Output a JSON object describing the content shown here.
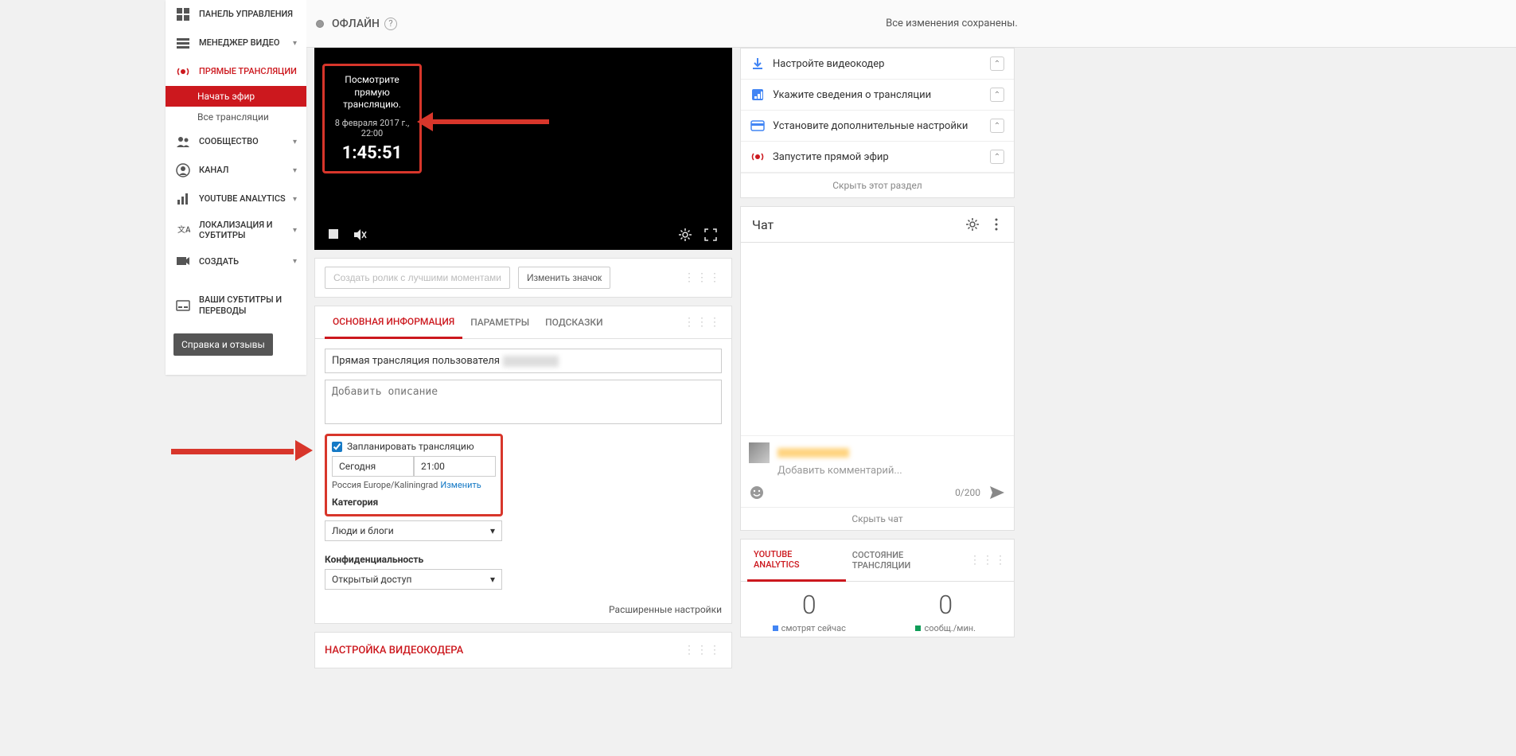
{
  "sidebar": {
    "items": [
      {
        "label": "ПАНЕЛЬ УПРАВЛЕНИЯ"
      },
      {
        "label": "МЕНЕДЖЕР ВИДЕО"
      },
      {
        "label": "ПРЯМЫЕ ТРАНСЛЯЦИИ"
      },
      {
        "label": "СООБЩЕСТВО"
      },
      {
        "label": "КАНАЛ"
      },
      {
        "label": "YOUTUBE ANALYTICS"
      },
      {
        "label": "ЛОКАЛИЗАЦИЯ И СУБТИТРЫ"
      },
      {
        "label": "СОЗДАТЬ"
      },
      {
        "label": "ВАШИ СУБТИТРЫ И ПЕРЕВОДЫ"
      }
    ],
    "sub_start": "Начать эфир",
    "sub_all": "Все трансляции",
    "help_button": "Справка и отзывы"
  },
  "header": {
    "status": "ОФЛАЙН",
    "saved": "Все изменения сохранены."
  },
  "player": {
    "overlay_title": "Посмотрите прямую трансляцию.",
    "overlay_date": "8 февраля 2017 г., 22:00",
    "overlay_countdown": "1:45:51"
  },
  "thumbnail_bar": {
    "create_clip": "Создать ролик с лучшими моментами",
    "change_thumb": "Изменить значок"
  },
  "tabs": {
    "basic": "ОСНОВНАЯ ИНФОРМАЦИЯ",
    "params": "ПАРАМЕТРЫ",
    "hints": "ПОДСКАЗКИ"
  },
  "form": {
    "title_prefix": "Прямая трансляция пользователя",
    "desc_placeholder": "Добавить описание",
    "schedule_label": "Запланировать трансляцию",
    "date_value": "Сегодня",
    "time_value": "21:00",
    "tz_text": "Россия Europe/Kaliningrad",
    "tz_change": "Изменить",
    "category_label": "Категория",
    "category_value": "Люди и блоги",
    "privacy_label": "Конфиденциальность",
    "privacy_value": "Открытый доступ",
    "advanced": "Расширенные настройки"
  },
  "encoder_section": "НАСТРОЙКА ВИДЕОКОДЕРА",
  "checklist": {
    "items": [
      {
        "label": "Настройте видеокодер"
      },
      {
        "label": "Укажите сведения о трансляции"
      },
      {
        "label": "Установите дополнительные настройки"
      },
      {
        "label": "Запустите прямой эфир"
      }
    ],
    "hide": "Скрыть этот раздел"
  },
  "chat": {
    "title": "Чат",
    "placeholder": "Добавить комментарий...",
    "count": "0/200",
    "hide": "Скрыть чат"
  },
  "analytics": {
    "tab1": "YOUTUBE ANALYTICS",
    "tab2": "СОСТОЯНИЕ ТРАНСЛЯЦИИ",
    "stat1_num": "0",
    "stat1_label": "смотрят сейчас",
    "stat2_num": "0",
    "stat2_label": "сообщ./мин."
  }
}
